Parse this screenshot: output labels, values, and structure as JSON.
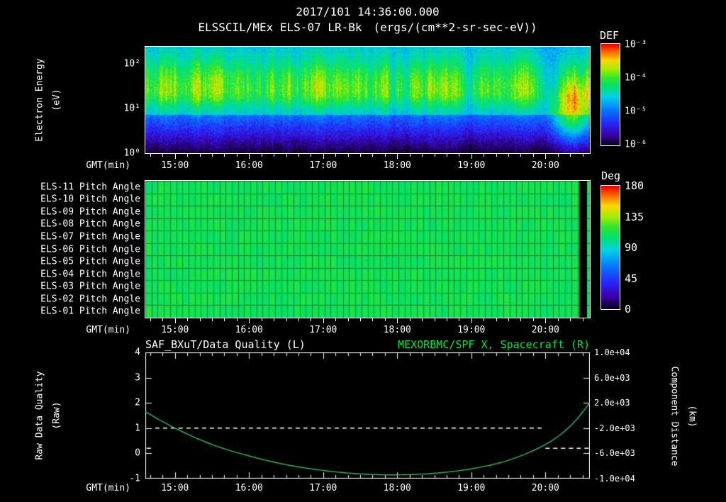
{
  "header": {
    "datetime": "2017/101 14:36:00.000",
    "instrument_title": "ELSSCIL/MEx ELS-07 LR-Bk",
    "units": "(ergs/(cm**2-sr-sec-eV))"
  },
  "time_axis": {
    "label": "GMT(min)",
    "start": "14:36",
    "end": "20:36",
    "hour_labels": [
      "15:00",
      "16:00",
      "17:00",
      "18:00",
      "19:00",
      "20:00"
    ]
  },
  "spectrogram": {
    "ylabel_line1": "Electron Energy",
    "ylabel_line2": "(eV)",
    "ytick_labels": [
      "10²",
      "10¹",
      "10⁰"
    ],
    "colorbar": {
      "title": "DEF",
      "tick_labels": [
        "10⁻³",
        "10⁻⁴",
        "10⁻⁵",
        "10⁻⁶"
      ]
    }
  },
  "pitch": {
    "row_labels": [
      "ELS-11 Pitch Angle",
      "ELS-10 Pitch Angle",
      "ELS-09 Pitch Angle",
      "ELS-08 Pitch Angle",
      "ELS-07 Pitch Angle",
      "ELS-06 Pitch Angle",
      "ELS-05 Pitch Angle",
      "ELS-04 Pitch Angle",
      "ELS-03 Pitch Angle",
      "ELS-02 Pitch Angle",
      "ELS-01 Pitch Angle"
    ],
    "colorbar": {
      "title": "Deg",
      "tick_labels": [
        "180",
        "135",
        "90",
        "45",
        "0"
      ]
    }
  },
  "timeseries": {
    "left_title": "SAF_BXuT/Data Quality (L)",
    "right_title": "MEXORBMC/SPF X, Spacecraft (R)",
    "left_ylabel_line1": "Raw Data Quality",
    "left_ylabel_line2": "(Raw)",
    "right_ylabel_line1": "Component Distance",
    "right_ylabel_line2": "(km)",
    "left_tick_labels": [
      "4",
      "3",
      "2",
      "1",
      "0",
      "-1"
    ],
    "right_tick_labels": [
      "1.0e+04",
      "6.0e+03",
      "2.0e+03",
      "-2.0e+03",
      "-6.0e+03",
      "-1.0e+04"
    ]
  },
  "colors": {
    "background": "#000000",
    "text": "#ffffff",
    "right_title_green": "#00e53c",
    "curve_green": "#2fbf54",
    "quality_white": "#ffffff",
    "pitch_fill_green": "#15e44e"
  },
  "chart_data": [
    {
      "type": "heatmap",
      "panel": "electron-energy-spectrogram",
      "title": "ELSSCIL/MEx ELS-07 LR-Bk",
      "z_units": "ergs/(cm**2-sr-sec-eV)",
      "xlabel": "GMT(min)",
      "x_range": [
        "14:36",
        "20:36"
      ],
      "x_ticks": [
        "15:00",
        "16:00",
        "17:00",
        "18:00",
        "19:00",
        "20:00"
      ],
      "ylabel": "Electron Energy (eV)",
      "y_scale": "log",
      "y_range_ev": [
        1,
        240
      ],
      "colorbar_label": "DEF",
      "colorbar_ticks": [
        0.001,
        0.0001,
        1e-05,
        1e-06
      ],
      "colormap": "rainbow",
      "features": [
        {
          "region": "main band",
          "energy_ev": [
            9,
            70
          ],
          "peak_ev": 26,
          "flux_ergs": 8e-05,
          "time": [
            "14:36",
            "20:36"
          ],
          "texture": "vertical striations, yellow-green patches on green band"
        },
        {
          "region": "suprathermal background above band",
          "energy_ev": [
            70,
            240
          ],
          "flux_ergs": 1.8e-05
        },
        {
          "region": "low-energy trough",
          "energy_ev": [
            1,
            7
          ],
          "flux_ergs": 6e-07,
          "texture": "dark blue / black speckle"
        },
        {
          "region": "bright low-energy blob near end",
          "time": [
            "20:08",
            "20:30"
          ],
          "energy_ev": [
            3,
            40
          ],
          "flux_ergs": 9e-05
        }
      ]
    },
    {
      "type": "heatmap",
      "panel": "pitch-angle",
      "rows": [
        "ELS-11",
        "ELS-10",
        "ELS-09",
        "ELS-08",
        "ELS-07",
        "ELS-06",
        "ELS-05",
        "ELS-04",
        "ELS-03",
        "ELS-02",
        "ELS-01"
      ],
      "xlabel": "GMT(min)",
      "x_range": [
        "14:36",
        "20:36"
      ],
      "x_ticks": [
        "15:00",
        "16:00",
        "17:00",
        "18:00",
        "19:00",
        "20:00"
      ],
      "colorbar_label": "Deg",
      "colorbar_ticks": [
        180,
        135,
        90,
        45,
        0
      ],
      "value_deg_approx": 110,
      "note": "all 11 anodes near-uniform green (~100-115 deg) across whole interval; narrow black data gap near 20:28"
    },
    {
      "type": "line",
      "panel": "timeseries",
      "xlabel": "GMT(min)",
      "x_range": [
        "14:36",
        "20:36"
      ],
      "x_ticks": [
        "15:00",
        "16:00",
        "17:00",
        "18:00",
        "19:00",
        "20:00"
      ],
      "left_axis": {
        "label": "Raw Data Quality (Raw)",
        "range": [
          -1,
          4
        ],
        "ticks": [
          4,
          3,
          2,
          1,
          0,
          -1
        ]
      },
      "right_axis": {
        "label": "Component Distance (km)",
        "range": [
          -10000,
          10000
        ],
        "ticks": [
          10000,
          6000,
          2000,
          -2000,
          -6000,
          -10000
        ]
      },
      "series": [
        {
          "name": "SAF_BXuT/Data Quality (L)",
          "axis": "left",
          "color": "#ffffff",
          "style": "dashed",
          "segments": [
            {
              "t": [
                "14:37",
                "14:43"
              ],
              "value": 0.2
            },
            {
              "t": [
                "14:44",
                "19:57"
              ],
              "value": 1.0
            },
            {
              "t": [
                "20:00",
                "20:35"
              ],
              "value": 0.2
            }
          ]
        },
        {
          "name": "MEXORBMC/SPF X, Spacecraft (R)",
          "axis": "right",
          "color": "#2fbf54",
          "style": "solid",
          "points_t": [
            "14:36",
            "15:00",
            "15:30",
            "16:00",
            "16:30",
            "17:00",
            "17:30",
            "18:00",
            "18:30",
            "19:00",
            "19:30",
            "20:00",
            "20:20",
            "20:36"
          ],
          "points_km": [
            600,
            -2000,
            -4600,
            -6400,
            -7800,
            -8700,
            -9250,
            -9400,
            -9150,
            -8450,
            -7100,
            -4600,
            -1700,
            2000
          ]
        }
      ]
    }
  ]
}
